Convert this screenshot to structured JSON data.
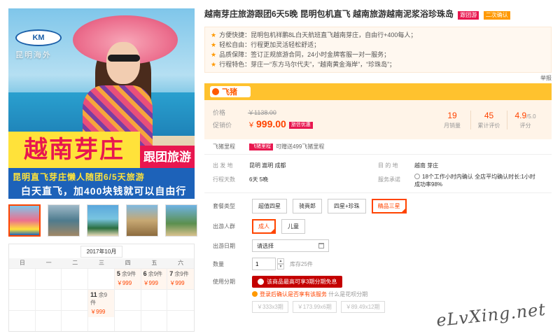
{
  "hero": {
    "logo_mark": "KM",
    "logo_text": "昆明海外",
    "banner_title": "越南芽庄",
    "banner_tag": "跟团旅游",
    "banner_line1": "昆明直飞芽庄懒人随团6/5天旅游",
    "banner_line2": "白天直飞，加400块钱就可以自由行"
  },
  "thumbnails": [
    "t1",
    "t2",
    "t3",
    "t4",
    "t5"
  ],
  "calendar": {
    "month": "2017年10月",
    "weekdays": [
      "日",
      "一",
      "二",
      "三",
      "四",
      "五",
      "六"
    ],
    "rows": [
      [
        {
          "d": ""
        },
        {
          "d": ""
        },
        {
          "d": ""
        },
        {
          "d": ""
        },
        {
          "d": "5",
          "rem": "余9件",
          "price": "￥999"
        },
        {
          "d": "6",
          "rem": "余9件",
          "price": "￥999"
        },
        {
          "d": "7",
          "rem": "余9件",
          "price": "￥999"
        }
      ],
      [
        {
          "d": ""
        },
        {
          "d": ""
        },
        {
          "d": ""
        },
        {
          "d": "11",
          "rem": "余9件",
          "price": "￥999"
        },
        {
          "d": ""
        },
        {
          "d": ""
        },
        {
          "d": ""
        }
      ],
      [
        {
          "d": ""
        },
        {
          "d": ""
        },
        {
          "d": ""
        },
        {
          "d": ""
        },
        {
          "d": ""
        },
        {
          "d": ""
        },
        {
          "d": ""
        }
      ]
    ]
  },
  "product": {
    "title": "越南芽庄旅游跟团6天5晚 昆明包机直飞 越南旅游越南泥浆浴珍珠岛",
    "tag1": "跟团游",
    "tag2": "二次确认",
    "features": [
      "方便快捷：昆明包机祥鹏8L白天航班直飞越南芽庄，自由行+400每人；",
      "轻松自由：行程更加灵活轻松舒适；",
      "品质保障：签订正规旅游合同，24小时金牌客服一对一服务；",
      "行程特色：芽庄一“东方马尔代夫”，“越南黄金海岸”，“珍珠岛”；"
    ],
    "report": "举报"
  },
  "fliggy": {
    "name": "飞猪"
  },
  "price": {
    "orig_label": "价格",
    "orig_value": "￥1138.00",
    "promo_label": "促销价",
    "currency": "￥",
    "promo_value": "999.00",
    "promo_badge": "旅信优惠",
    "stats": [
      {
        "v": "19",
        "k": "月销量"
      },
      {
        "v": "45",
        "k": "累计评价"
      },
      {
        "v": "4.9",
        "sub": "/5.0",
        "k": "评分"
      }
    ]
  },
  "mileage": {
    "label": "飞猪里程",
    "tag": "飞猪里程",
    "text": "可赠送499飞猪里程"
  },
  "info": {
    "depart_k": "出 发 地",
    "depart_v": "昆明  嵩明  成都",
    "dest_k": "目 的 地",
    "dest_v": "越南  芽庄",
    "days_k": "行程天数",
    "days_v": "6天  5晚",
    "svc_k": "服务承诺",
    "svc_v": "18个工作小时内确认 全店平均确认时长:1小时",
    "svc_v2": "成功率98%"
  },
  "options": {
    "package_k": "套餐类型",
    "packages": [
      "超值四星",
      "骑頁郎",
      "四星+珍珠",
      "精品三星"
    ],
    "crowd_k": "出游人群",
    "crowd": [
      "成人",
      "儿童"
    ],
    "date_k": "出游日期",
    "date_placeholder": "请选择",
    "qty_k": "数量",
    "qty_value": "1",
    "stock": "库存25件",
    "inst_k": "使用分期",
    "inst_btn": "该商品最高可享3期分期免息",
    "inst_tip": "登录后确认是否享有该服务",
    "inst_tip_link": "什么是花呗分期",
    "plans": [
      "￥333x3期",
      "￥173.99x6期",
      "￥89.49x12期"
    ]
  },
  "watermark": "eLvXing.net"
}
